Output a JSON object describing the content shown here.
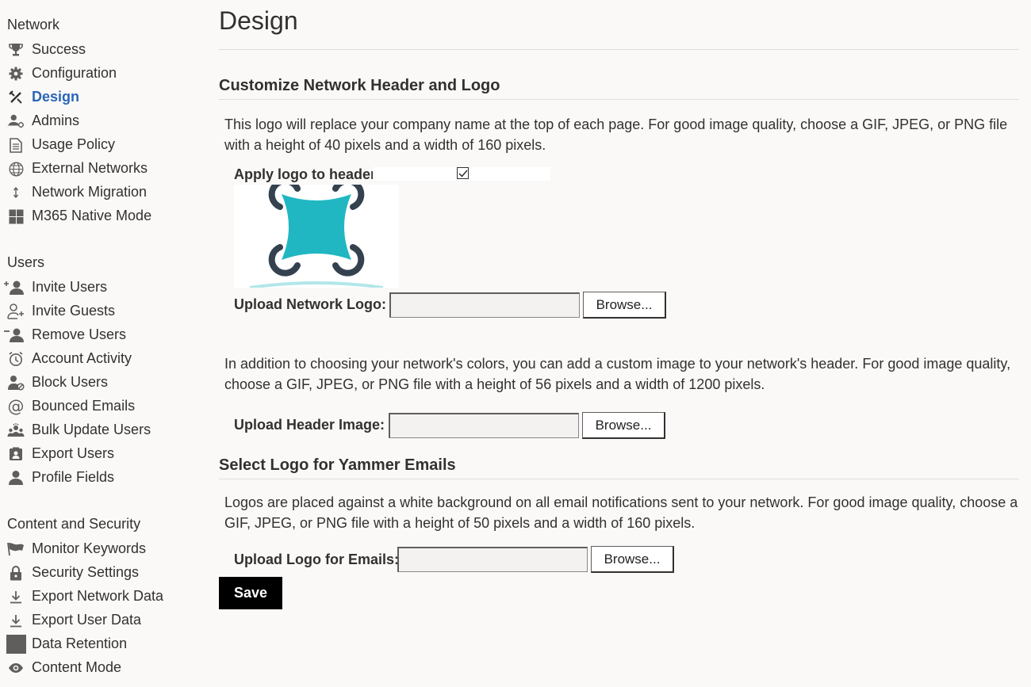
{
  "sidebar": {
    "sections": [
      {
        "title": "Network",
        "items": [
          {
            "label": "Success",
            "icon": "trophy-icon",
            "active": false
          },
          {
            "label": "Configuration",
            "icon": "gear-icon",
            "active": false
          },
          {
            "label": "Design",
            "icon": "design-tools-icon",
            "active": true
          },
          {
            "label": "Admins",
            "icon": "admin-user-icon",
            "active": false
          },
          {
            "label": "Usage Policy",
            "icon": "document-icon",
            "active": false
          },
          {
            "label": "External Networks",
            "icon": "globe-icon",
            "active": false
          },
          {
            "label": "Network Migration",
            "icon": "up-down-arrow-icon",
            "active": false
          },
          {
            "label": "M365 Native Mode",
            "icon": "windows-grid-icon",
            "active": false
          }
        ]
      },
      {
        "title": "Users",
        "items": [
          {
            "label": "Invite Users",
            "icon": "add-user-icon",
            "active": false
          },
          {
            "label": "Invite Guests",
            "icon": "guest-user-icon",
            "active": false
          },
          {
            "label": "Remove Users",
            "icon": "remove-user-icon",
            "active": false
          },
          {
            "label": "Account Activity",
            "icon": "alarm-clock-icon",
            "active": false
          },
          {
            "label": "Block Users",
            "icon": "block-user-icon",
            "active": false
          },
          {
            "label": "Bounced Emails",
            "icon": "at-sign-icon",
            "active": false
          },
          {
            "label": "Bulk Update Users",
            "icon": "group-users-icon",
            "active": false
          },
          {
            "label": "Export Users",
            "icon": "contact-card-icon",
            "active": false
          },
          {
            "label": "Profile Fields",
            "icon": "user-icon",
            "active": false
          }
        ]
      },
      {
        "title": "Content and Security",
        "items": [
          {
            "label": "Monitor Keywords",
            "icon": "flag-icon",
            "active": false
          },
          {
            "label": "Security Settings",
            "icon": "lock-icon",
            "active": false
          },
          {
            "label": "Export Network Data",
            "icon": "download-icon",
            "active": false
          },
          {
            "label": "Export User Data",
            "icon": "download-icon",
            "active": false
          },
          {
            "label": "Data Retention",
            "icon": "square-icon",
            "active": false
          },
          {
            "label": "Content Mode",
            "icon": "eye-icon",
            "active": false
          }
        ]
      }
    ]
  },
  "main": {
    "title": "Design",
    "header_logo_section": {
      "heading": "Customize Network Header and Logo",
      "description": "This logo will replace your company name at the top of each page. For good image quality, choose a GIF, JPEG, or PNG file with a height of 40 pixels and a width of 160 pixels.",
      "apply_logo_label": "Apply logo to header",
      "apply_logo_checked": true,
      "upload_logo_label": "Upload Network Logo:",
      "browse_label": "Browse...",
      "header_image_description": "In addition to choosing your network's colors, you can add a custom image to your network's header. For good image quality, choose a GIF, JPEG, or PNG file with a height of 56 pixels and a width of 1200 pixels.",
      "upload_header_label": "Upload Header Image:"
    },
    "email_logo_section": {
      "heading": "Select Logo for Yammer Emails",
      "description": "Logos are placed against a white background on all email notifications sent to your network. For good image quality, choose a GIF, JPEG, or PNG file with a height of 50 pixels and a width of 160 pixels.",
      "upload_label": "Upload Logo for Emails:"
    },
    "save_label": "Save"
  },
  "colors": {
    "accent": "#2b66b8",
    "logo_teal": "#21b7c2",
    "logo_dark": "#34424f",
    "save_button": "#000000"
  }
}
